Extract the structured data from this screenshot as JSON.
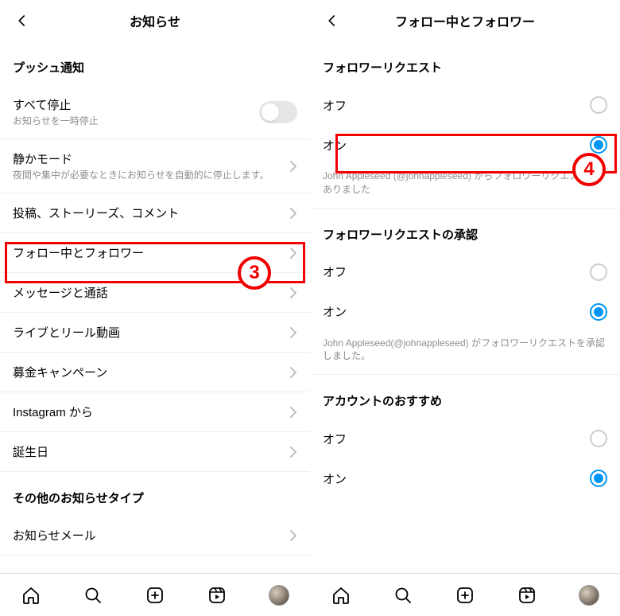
{
  "left": {
    "title": "お知らせ",
    "section1": "プッシュ通知",
    "pause_title": "すべて停止",
    "pause_sub": "お知らせを一時停止",
    "quiet_title": "静かモード",
    "quiet_sub": "夜間や集中が必要なときにお知らせを自動的に停止します。",
    "rows": {
      "posts": "投稿、ストーリーズ、コメント",
      "following": "フォロー中とフォロワー",
      "messages": "メッセージと通話",
      "live": "ライブとリール動画",
      "fund": "募金キャンペーン",
      "instagram": "Instagram から",
      "birthday": "誕生日"
    },
    "section2": "その他のお知らせタイプ",
    "email": "お知らせメール"
  },
  "right": {
    "title": "フォロー中とフォロワー",
    "req_title": "フォロワーリクエスト",
    "off": "オフ",
    "on": "オン",
    "req_desc": "John Appleseed (@johnappleseed) からフォロワーリクエストがありました",
    "approve_title": "フォロワーリクエストの承認",
    "approve_desc": "John Appleseed(@johnappleseed) がフォロワーリクエストを承認しました。",
    "suggest_title": "アカウントのおすすめ"
  },
  "callouts": {
    "c3": "3",
    "c4": "4"
  }
}
